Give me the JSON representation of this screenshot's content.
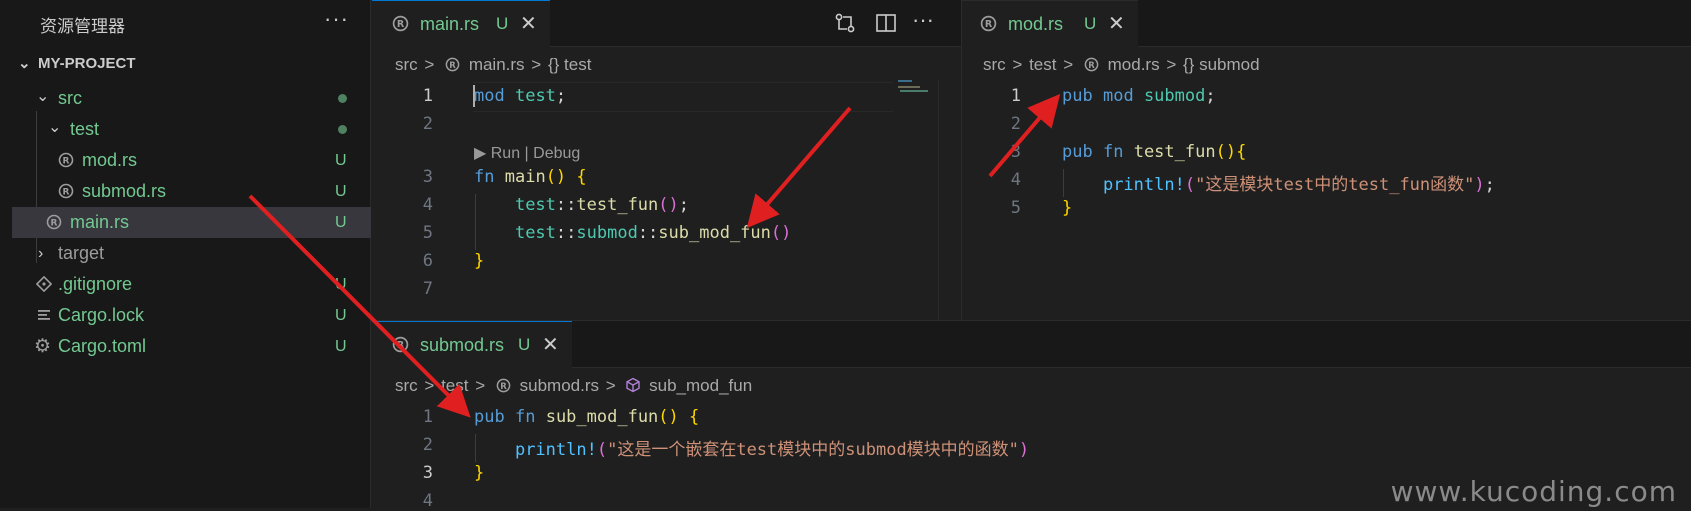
{
  "explorer": {
    "title": "资源管理器",
    "more": "···",
    "project": "MY-PROJECT",
    "items": [
      {
        "label": "src",
        "status": "dot"
      },
      {
        "label": "test",
        "status": "dot"
      },
      {
        "label": "mod.rs",
        "status": "U"
      },
      {
        "label": "submod.rs",
        "status": "U"
      },
      {
        "label": "main.rs",
        "status": "U"
      },
      {
        "label": "target",
        "status": ""
      },
      {
        "label": ".gitignore",
        "status": "U"
      },
      {
        "label": "Cargo.lock",
        "status": "U"
      },
      {
        "label": "Cargo.toml",
        "status": "U"
      }
    ]
  },
  "editor_main": {
    "tab": {
      "name": "main.rs",
      "badge": "U",
      "close": "✕"
    },
    "breadcrumb": [
      "src",
      ">",
      "main.rs",
      ">",
      "{} test"
    ],
    "codelens": "▶ Run | Debug",
    "line_numbers": [
      "1",
      "2",
      "3",
      "4",
      "5",
      "6",
      "7"
    ]
  },
  "editor_mod": {
    "tab": {
      "name": "mod.rs",
      "badge": "U",
      "close": "✕"
    },
    "breadcrumb": [
      "src",
      ">",
      "test",
      ">",
      "mod.rs",
      ">",
      "{} submod"
    ],
    "line_numbers": [
      "1",
      "2",
      "3",
      "4",
      "5"
    ]
  },
  "editor_submod": {
    "tab": {
      "name": "submod.rs",
      "badge": "U",
      "close": "✕"
    },
    "breadcrumb": [
      "src",
      ">",
      "test",
      ">",
      "submod.rs",
      ">",
      "sub_mod_fun"
    ],
    "line_numbers": [
      "1",
      "2",
      "3",
      "4"
    ]
  },
  "watermark": "www.kucoding.com",
  "colors": {
    "accent": "#0078d4",
    "untracked": "#73c991",
    "arrow": "#e02020",
    "keyword": "#569cd6",
    "function": "#dcdcaa",
    "string": "#ce9178"
  }
}
